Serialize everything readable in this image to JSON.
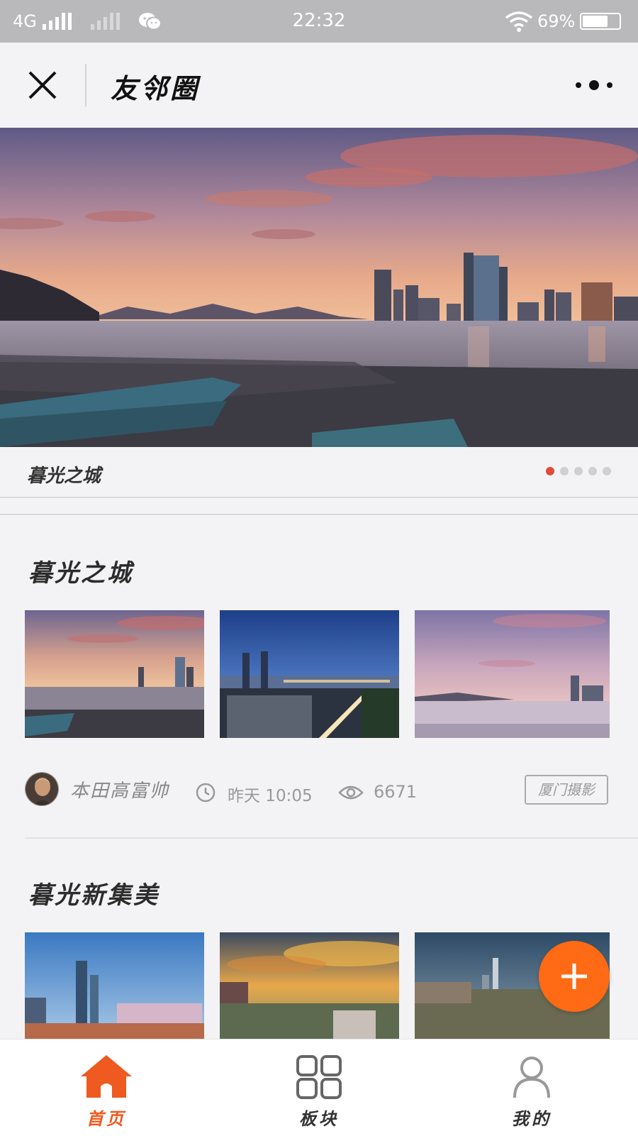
{
  "status_bar": {
    "network": "4G",
    "time": "22:32",
    "battery_pct_text": "69%",
    "battery_level": 0.69
  },
  "header": {
    "title": "友邻圈",
    "close_icon": "close-icon",
    "more_icon": "more-icon"
  },
  "banner": {
    "caption": "暮光之城",
    "slide_count": 5,
    "active_slide": 1
  },
  "posts": [
    {
      "title": "暮光之城",
      "author": "本田高富帅",
      "time": "昨天 10:05",
      "views": "6671",
      "tag": "厦门摄影"
    },
    {
      "title": "暮光新集美"
    }
  ],
  "fab": {
    "icon": "plus-icon"
  },
  "tabbar": {
    "items": [
      {
        "label": "首页",
        "icon": "home-icon",
        "active": true
      },
      {
        "label": "板块",
        "icon": "grid-icon",
        "active": false
      },
      {
        "label": "我的",
        "icon": "user-icon",
        "active": false
      }
    ]
  },
  "colors": {
    "accent": "#ff6a14",
    "active_tab": "#ee5a1f",
    "dot_active": "#e04b38"
  }
}
